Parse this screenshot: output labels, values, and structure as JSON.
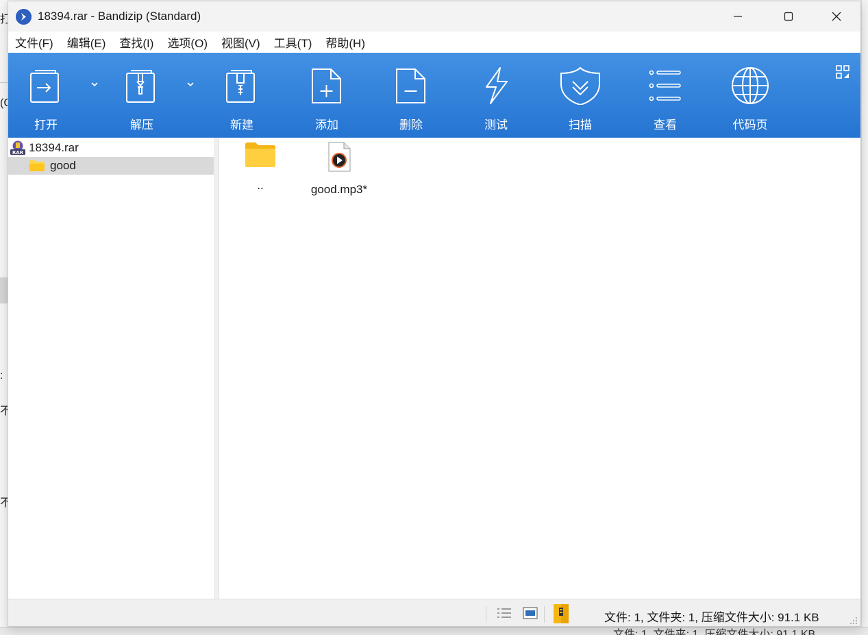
{
  "background_window": {
    "frag_top": "打",
    "frag_left": "(C",
    "frag_mid": ":",
    "frag_a": "不",
    "frag_b": "不",
    "status_text": "文件: 1, 文件夹: 1, 压缩文件大小: 91.1 KB"
  },
  "window": {
    "title": "18394.rar - Bandizip (Standard)"
  },
  "menu": [
    "文件(F)",
    "编辑(E)",
    "查找(I)",
    "选项(O)",
    "视图(V)",
    "工具(T)",
    "帮助(H)"
  ],
  "toolbar": {
    "buttons": [
      {
        "label": "打开",
        "icon": "open-archive-icon"
      },
      {
        "label": "解压",
        "icon": "extract-icon"
      },
      {
        "label": "新建",
        "icon": "new-archive-icon"
      },
      {
        "label": "添加",
        "icon": "add-file-icon"
      },
      {
        "label": "删除",
        "icon": "delete-file-icon"
      },
      {
        "label": "测试",
        "icon": "test-lightning-icon"
      },
      {
        "label": "扫描",
        "icon": "scan-shield-icon"
      },
      {
        "label": "查看",
        "icon": "view-list-icon"
      },
      {
        "label": "代码页",
        "icon": "codepage-globe-icon"
      }
    ],
    "accent": "#2f80dc"
  },
  "tree": {
    "root": "18394.rar",
    "child": "good"
  },
  "files": [
    {
      "name": "..",
      "icon": "folder-icon"
    },
    {
      "name": "good.mp3*",
      "icon": "media-file-icon"
    }
  ],
  "status": {
    "text": "文件: 1, 文件夹: 1, 压缩文件大小: 91.1 KB"
  }
}
